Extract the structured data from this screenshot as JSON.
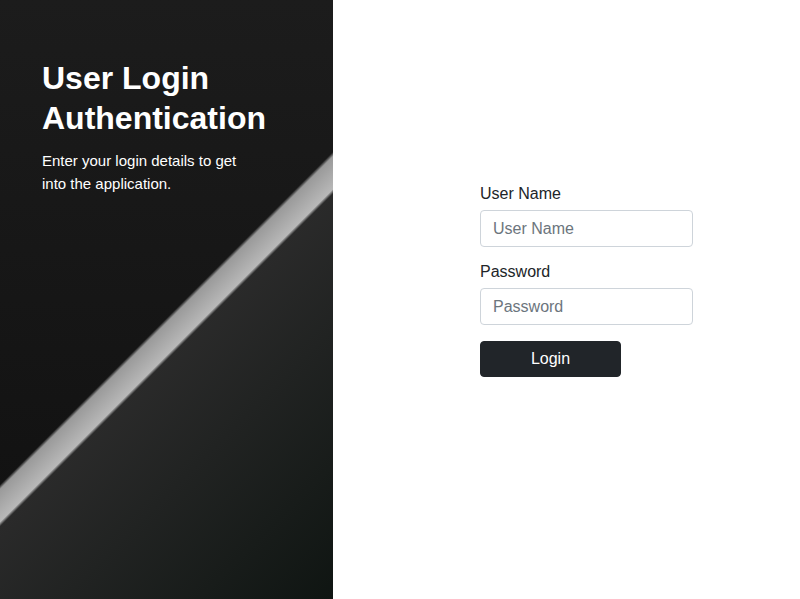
{
  "hero": {
    "title": "User Login Authentication",
    "subtitle": "Enter your login details to get into the application."
  },
  "form": {
    "fields": [
      {
        "label": "User Name",
        "placeholder": "User Name",
        "kind": "text"
      },
      {
        "label": "Password",
        "placeholder": "Password",
        "kind": "password"
      }
    ],
    "submit": "Login"
  }
}
